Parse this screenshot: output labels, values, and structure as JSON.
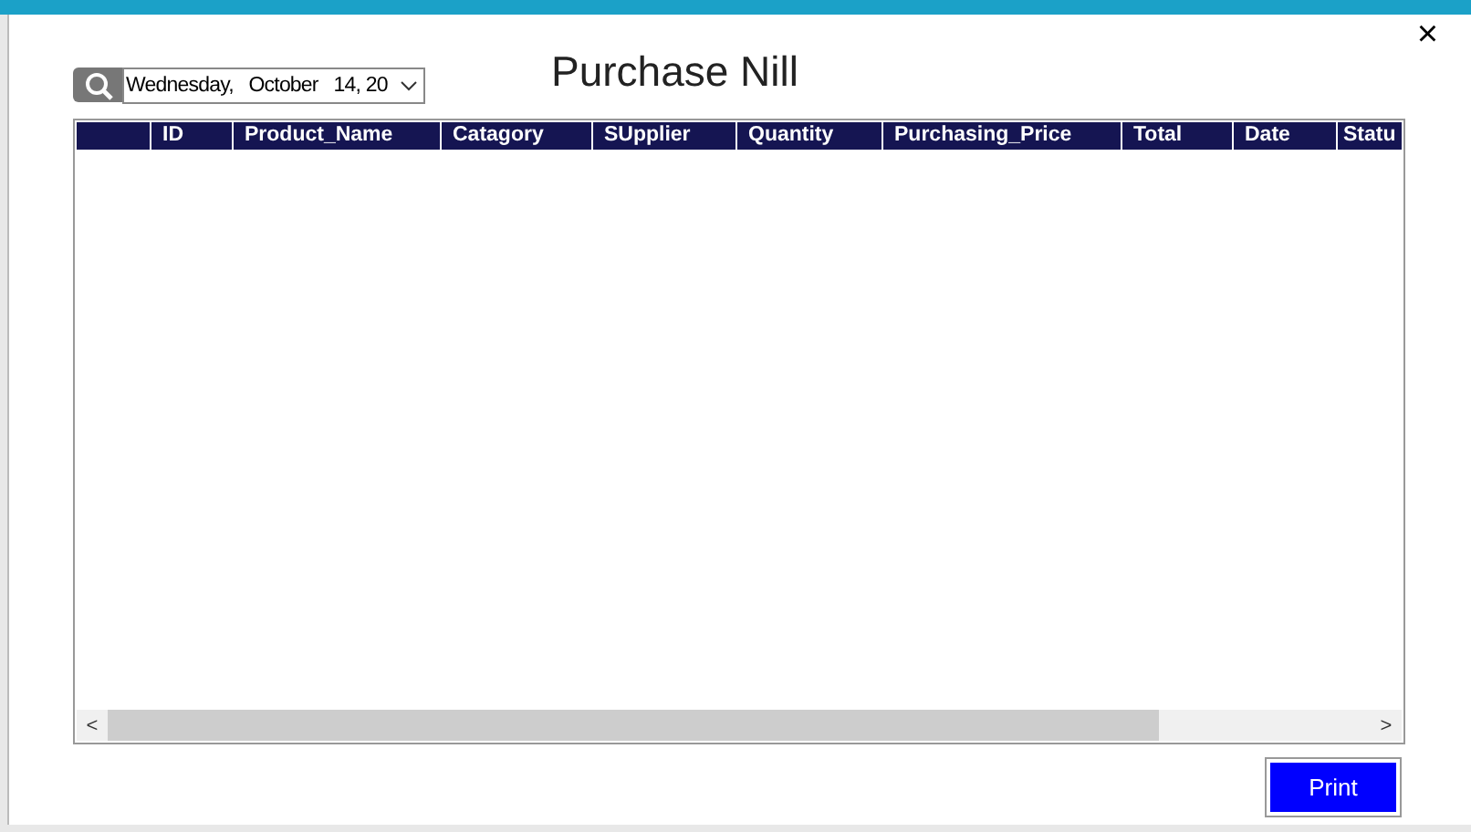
{
  "dialog": {
    "title": "Purchase Nill",
    "close": "×"
  },
  "date_picker": {
    "value": "Wednesday,   October   14, 20"
  },
  "grid": {
    "columns": [
      "ID",
      "Product_Name",
      "Catagory",
      "SUpplier",
      "Quantity",
      "Purchasing_Price",
      "Total",
      "Date",
      "Statu"
    ],
    "scroll_left": "<",
    "scroll_right": ">"
  },
  "buttons": [
    {
      "label": "Print"
    }
  ]
}
